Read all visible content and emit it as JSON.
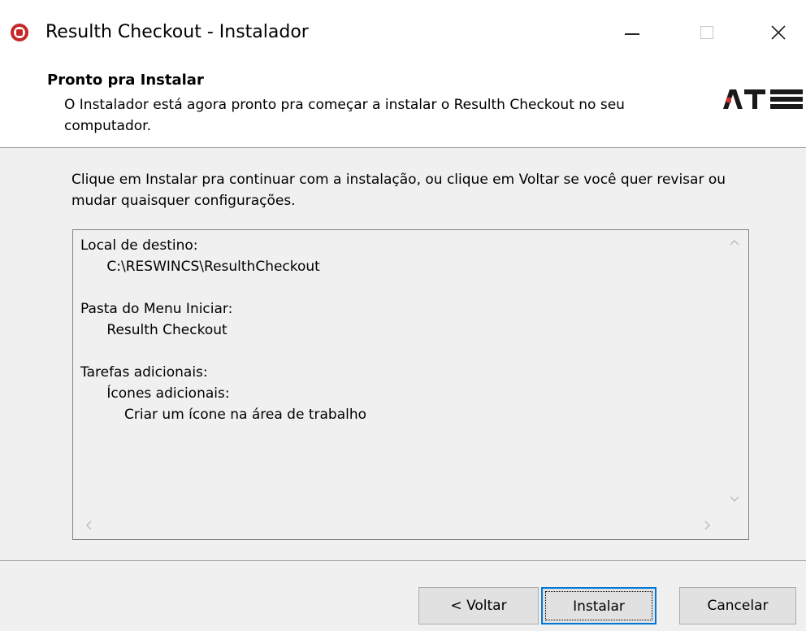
{
  "window": {
    "title": "Resulth Checkout - Instalador",
    "controls": {
      "minimize": "minimize",
      "maximize": "maximize",
      "close": "close"
    }
  },
  "header": {
    "title": "Pronto pra Instalar",
    "description": "O Instalador está agora pronto pra começar a instalar o Resulth Checkout no seu computador.",
    "logo_text": "ATS"
  },
  "body": {
    "instructions": "Clique em Instalar pra continuar com a instalação, ou clique em Voltar se você quer revisar ou mudar quaisquer configurações.",
    "summary": "Local de destino:\n      C:\\RESWINCS\\ResulthCheckout\n\nPasta do Menu Iniciar:\n      Resulth Checkout\n\nTarefas adicionais:\n      Ícones adicionais:\n          Criar um ícone na área de trabalho"
  },
  "buttons": {
    "back": "< Voltar",
    "install": "Instalar",
    "cancel": "Cancelar"
  },
  "colors": {
    "accent": "#0078d7",
    "app_icon": "#c62828",
    "dialog_bg": "#f0f0f0"
  }
}
